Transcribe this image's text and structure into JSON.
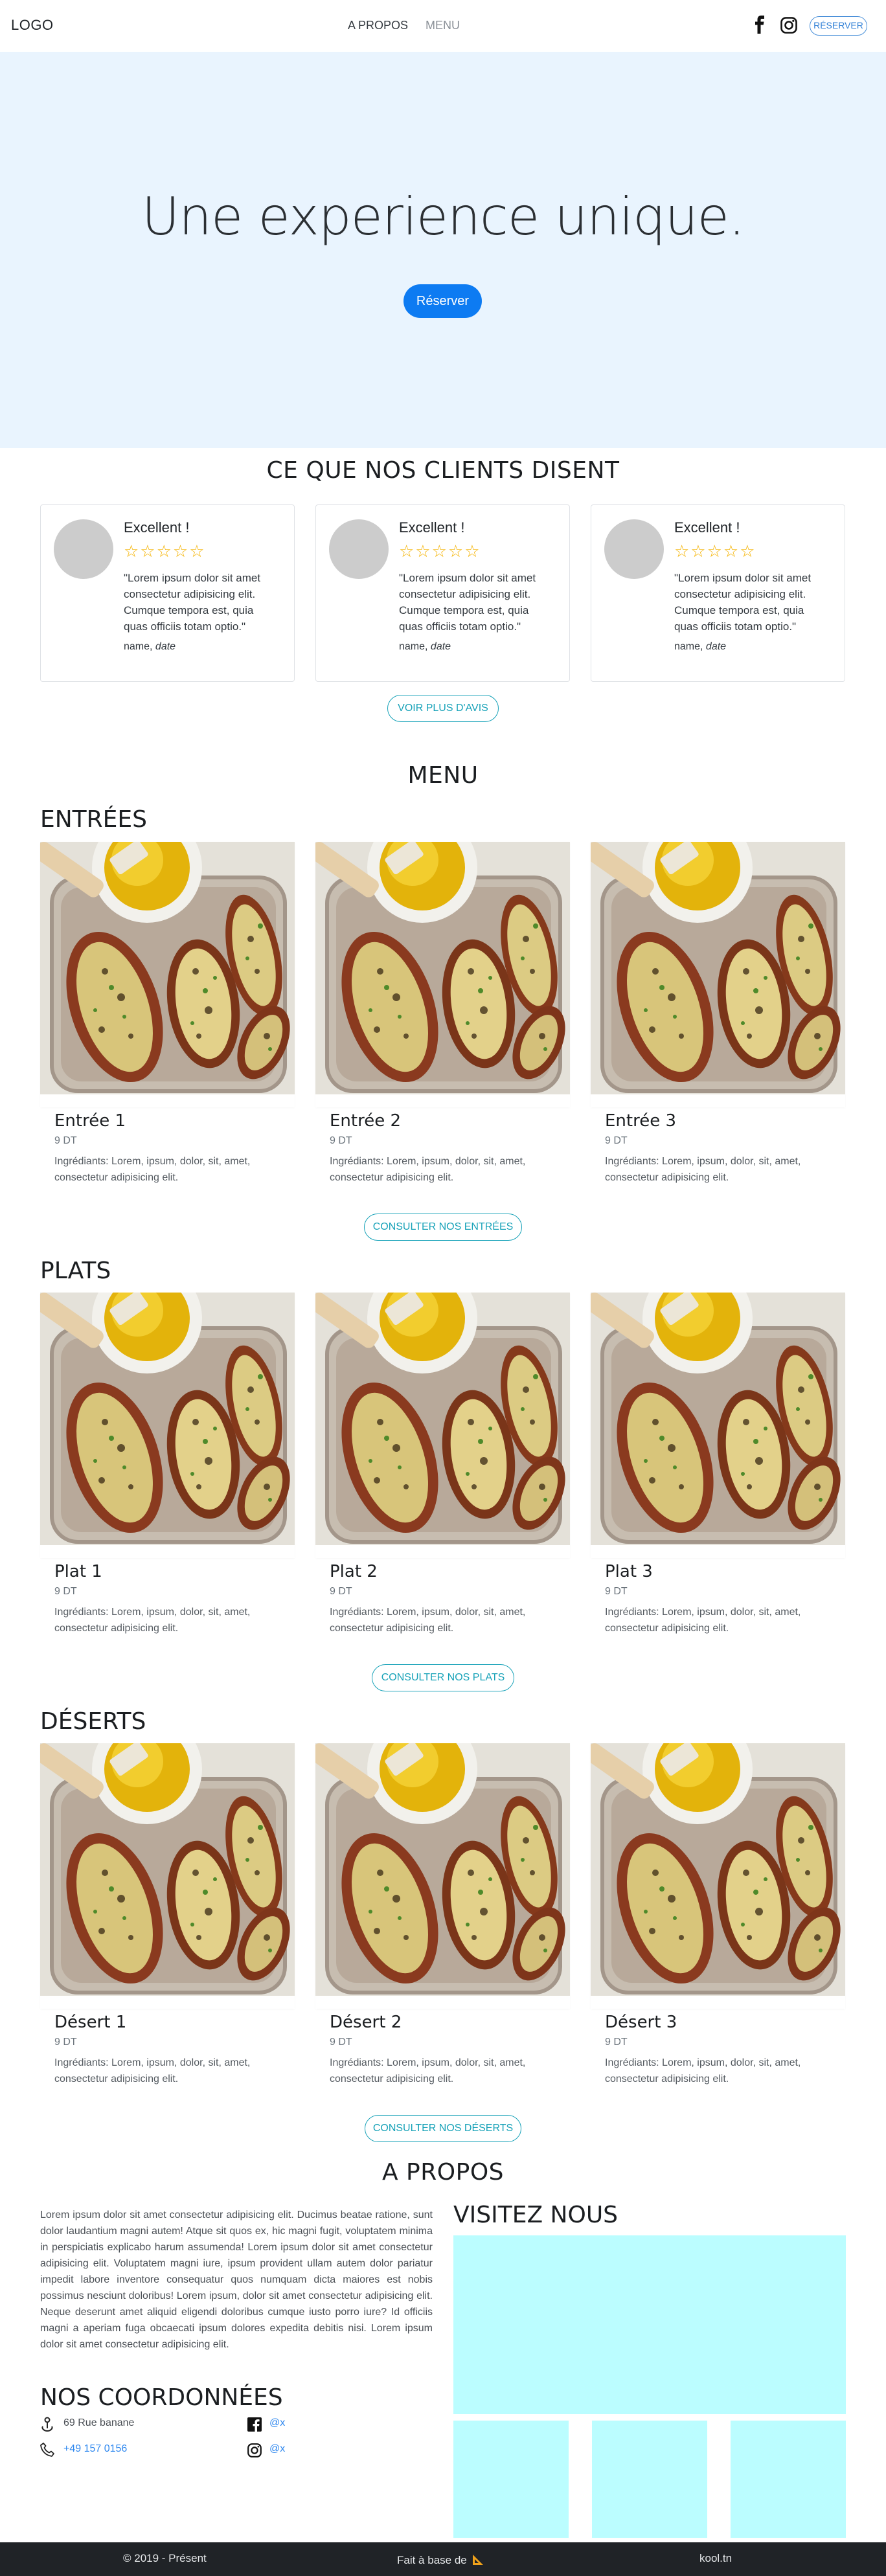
{
  "navbar": {
    "logo": "LOGO",
    "links": [
      "A PROPOS",
      "MENU"
    ],
    "reserve_label": "RÉSERVER",
    "icons": [
      "facebook-icon",
      "instagram-icon"
    ]
  },
  "hero": {
    "title": "Une experience unique.",
    "button_label": "Réserver"
  },
  "reviews": {
    "title": "CE QUE NOS CLIENTS DISENT",
    "items": [
      {
        "title": "Excellent !",
        "stars": 5,
        "text": "\"Lorem ipsum dolor sit amet consectetur adipisicing elit. Cumque tempora est, quia quas officiis totam optio.\"",
        "name": "name,",
        "date": "date"
      },
      {
        "title": "Excellent !",
        "stars": 5,
        "text": "\"Lorem ipsum dolor sit amet consectetur adipisicing elit. Cumque tempora est, quia quas officiis totam optio.\"",
        "name": "name,",
        "date": "date"
      },
      {
        "title": "Excellent !",
        "stars": 5,
        "text": "\"Lorem ipsum dolor sit amet consectetur adipisicing elit. Cumque tempora est, quia quas officiis totam optio.\"",
        "name": "name,",
        "date": "date"
      }
    ],
    "more_label": "VOIR PLUS D'AVIS"
  },
  "menu": {
    "title": "MENU",
    "categories": [
      {
        "title": "ENTRÉES",
        "button": "CONSULTER NOS ENTRÉES",
        "items": [
          {
            "name": "Entrée 1",
            "price": "9 DT",
            "ingredients": "Ingrédiants: Lorem, ipsum, dolor, sit, amet, consectetur adipisicing elit."
          },
          {
            "name": "Entrée 2",
            "price": "9 DT",
            "ingredients": "Ingrédiants: Lorem, ipsum, dolor, sit, amet, consectetur adipisicing elit."
          },
          {
            "name": "Entrée 3",
            "price": "9 DT",
            "ingredients": "Ingrédiants: Lorem, ipsum, dolor, sit, amet, consectetur adipisicing elit."
          }
        ]
      },
      {
        "title": "PLATS",
        "button": "CONSULTER NOS PLATS",
        "items": [
          {
            "name": "Plat 1",
            "price": "9 DT",
            "ingredients": "Ingrédiants: Lorem, ipsum, dolor, sit, amet, consectetur adipisicing elit."
          },
          {
            "name": "Plat 2",
            "price": "9 DT",
            "ingredients": "Ingrédiants: Lorem, ipsum, dolor, sit, amet, consectetur adipisicing elit."
          },
          {
            "name": "Plat 3",
            "price": "9 DT",
            "ingredients": "Ingrédiants: Lorem, ipsum, dolor, sit, amet, consectetur adipisicing elit."
          }
        ]
      },
      {
        "title": "DÉSERTS",
        "button": "CONSULTER NOS DÉSERTS",
        "items": [
          {
            "name": "Désert 1",
            "price": "9 DT",
            "ingredients": "Ingrédiants: Lorem, ipsum, dolor, sit, amet, consectetur adipisicing elit."
          },
          {
            "name": "Désert 2",
            "price": "9 DT",
            "ingredients": "Ingrédiants: Lorem, ipsum, dolor, sit, amet, consectetur adipisicing elit."
          },
          {
            "name": "Désert 3",
            "price": "9 DT",
            "ingredients": "Ingrédiants: Lorem, ipsum, dolor, sit, amet, consectetur adipisicing elit."
          }
        ]
      }
    ]
  },
  "apropos": {
    "title": "A PROPOS",
    "text": "Lorem ipsum dolor sit amet consectetur adipisicing elit. Ducimus beatae ratione, sunt dolor laudantium magni autem! Atque sit quos ex, hic magni fugit, voluptatem minima in perspiciatis explicabo harum assumenda! Lorem ipsum dolor sit amet consectetur adipisicing elit. Voluptatem magni iure, ipsum provident ullam autem dolor pariatur impedit labore inventore consequatur quos numquam dicta maiores est nobis possimus nesciunt doloribus! Lorem ipsum, dolor sit amet consectetur adipisicing elit. Neque deserunt amet aliquid eligendi doloribus cumque iusto porro iure? Id officiis magni a aperiam fuga obcaecati ipsum dolores expedita debitis nisi. Lorem ipsum dolor sit amet consectetur adipisicing elit.",
    "coord_title": "NOS COORDONNÉES",
    "address": "69 Rue banane",
    "phone": "+49 157 0156",
    "facebook": "@x",
    "instagram": "@x",
    "visit_title": "VISITEZ NOUS",
    "photo_color": "#bbfdff"
  },
  "footer": {
    "copyright": "© 2019 - Présent",
    "made_with": "Fait à base de",
    "made_with_icon": "ruler-triangle-icon",
    "site": "kool.tn"
  },
  "colors": {
    "hero_bg": "#e9f4fe",
    "primary": "#0d7bf2",
    "info": "#17a2b8",
    "star": "#f5b301",
    "footer_bg": "#202327"
  }
}
